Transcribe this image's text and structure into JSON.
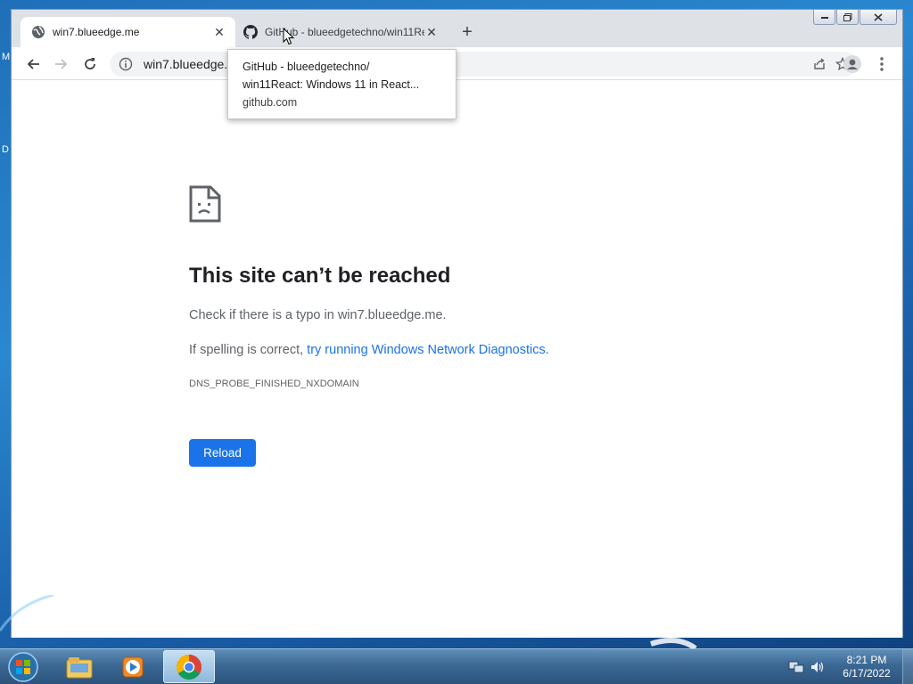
{
  "desktop": {
    "letters": [
      "M",
      "D"
    ]
  },
  "tabs": [
    {
      "title": "win7.blueedge.me",
      "active": true,
      "favicon": "globe-icon"
    },
    {
      "title": "GitHub - blueedgetechno/win11React: Windows 11 in React",
      "active": false,
      "favicon": "github-icon"
    }
  ],
  "toolbar": {
    "url": "win7.blueedge.me"
  },
  "tooltip": {
    "title_line1": "GitHub - blueedgetechno/",
    "title_line2": "win11React: Windows 11 in React...",
    "domain": "github.com"
  },
  "error_page": {
    "title": "This site can’t be reached",
    "check_text": "Check if there is a typo in win7.blueedge.me.",
    "spelling_prefix": "If spelling is correct, ",
    "spelling_link": "try running Windows Network Diagnostics",
    "spelling_suffix": ".",
    "error_code": "DNS_PROBE_FINISHED_NXDOMAIN",
    "reload_label": "Reload"
  },
  "taskbar": {
    "time": "8:21 PM",
    "date": "6/17/2022",
    "pinned": [
      "windows-explorer-icon",
      "media-player-icon",
      "chrome-icon"
    ]
  },
  "colors": {
    "link": "#1a73e8",
    "reload_button": "#1a73e8",
    "tab_strip": "#dee1e6"
  }
}
